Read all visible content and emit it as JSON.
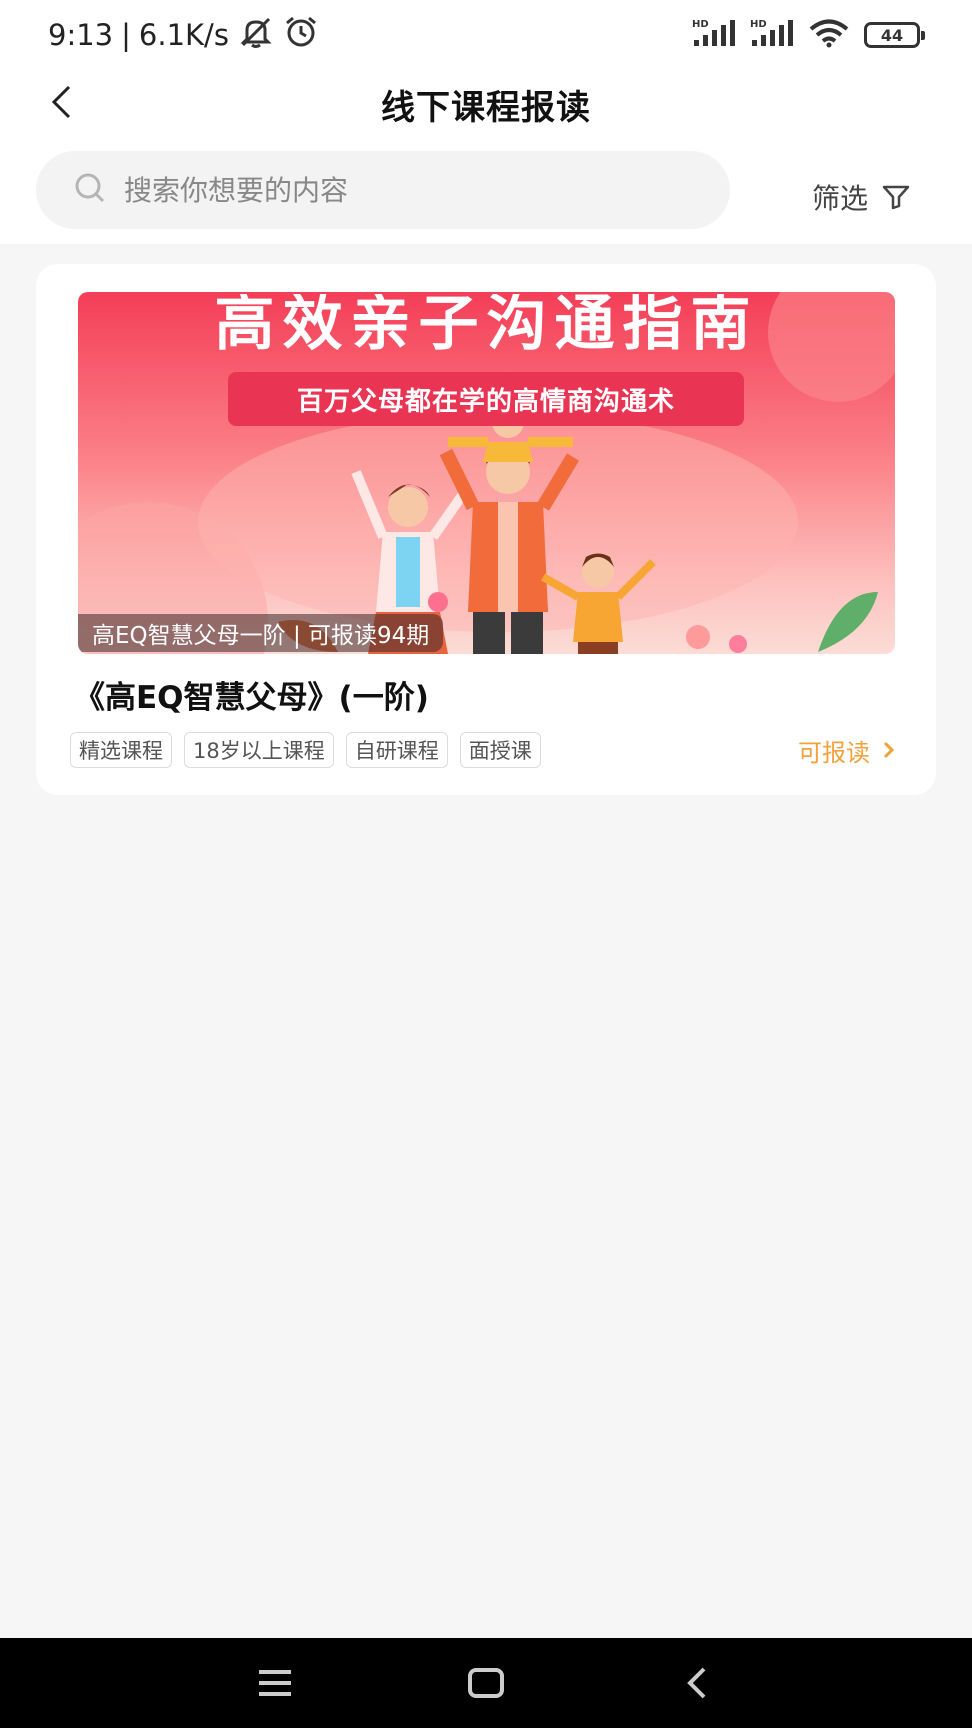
{
  "status_bar": {
    "time": "9:13",
    "separator": "|",
    "speed": "6.1K/s",
    "network_label": "HD",
    "battery": "44"
  },
  "header": {
    "title": "线下课程报读"
  },
  "search": {
    "placeholder": "搜索你想要的内容"
  },
  "filter": {
    "label": "筛选"
  },
  "courses": [
    {
      "banner_title": "高效亲子沟通指南",
      "banner_subtitle": "百万父母都在学的高情商沟通术",
      "banner_caption": "高EQ智慧父母一阶 | 可报读94期",
      "title": "《高EQ智慧父母》(一阶)",
      "tags": [
        "精选课程",
        "18岁以上课程",
        "自研课程",
        "面授课"
      ],
      "action_label": "可报读"
    }
  ],
  "colors": {
    "accent": "#f2a13c",
    "banner_red": "#f43e57",
    "page_bg": "#f6f6f6"
  }
}
